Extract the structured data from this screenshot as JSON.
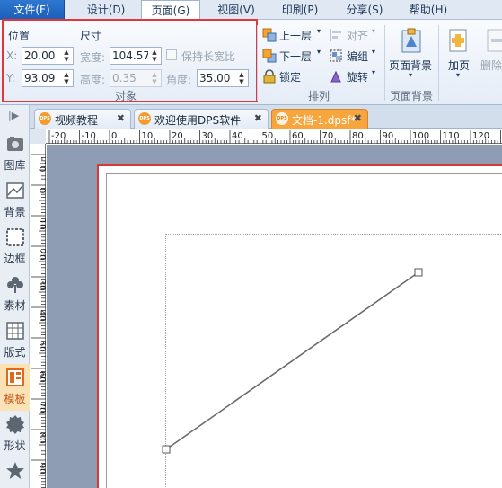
{
  "menu": {
    "file": "文件(F)",
    "design": "设计(D)",
    "page": "页面(G)",
    "view": "视图(V)",
    "print": "印刷(P)",
    "share": "分享(S)",
    "help": "帮助(H)"
  },
  "ribbon": {
    "position_label": "位置",
    "size_label": "尺寸",
    "x_label": "X:",
    "y_label": "Y:",
    "x_value": "20.00",
    "y_value": "93.09",
    "width_label": "宽度:",
    "width_value": "104.57",
    "height_label": "高度:",
    "height_value": "0.35",
    "keep_ratio_label": "保持长宽比",
    "angle_label": "角度:",
    "angle_value": "35.00",
    "object_group": "对象",
    "bring_forward": "上一层",
    "send_backward": "下一层",
    "lock": "锁定",
    "align": "对齐",
    "group": "编组",
    "rotate": "旋转",
    "arrange_group": "排列",
    "page_background": "页面背景",
    "page_background_group": "页面背景",
    "add_page": "加页",
    "delete_page": "删除"
  },
  "left_tools": [
    {
      "label": "图库",
      "icon": "gallery-icon"
    },
    {
      "label": "背景",
      "icon": "background-icon"
    },
    {
      "label": "边框",
      "icon": "border-icon"
    },
    {
      "label": "素材",
      "icon": "material-icon"
    },
    {
      "label": "版式",
      "icon": "layout-icon"
    },
    {
      "label": "模板",
      "icon": "template-icon"
    },
    {
      "label": "形状",
      "icon": "shape-icon"
    },
    {
      "label": "",
      "icon": "star-icon"
    }
  ],
  "tabs": [
    {
      "label": "视频教程",
      "badge": "DPS",
      "close": "✖",
      "active": false
    },
    {
      "label": "欢迎使用DPS软件",
      "badge": "DPS",
      "close": "✖",
      "active": false
    },
    {
      "label": "文档-1.dpsf*",
      "badge": "DPS",
      "close": "✖",
      "active": true
    }
  ],
  "ruler_h": [
    "-20",
    "-10",
    "0",
    "10",
    "20",
    "30",
    "40",
    "50",
    "60",
    "70",
    "80",
    "90",
    "100",
    "110",
    "120",
    "130"
  ],
  "ruler_v": [
    "-10",
    "0",
    "10",
    "20",
    "30",
    "40",
    "50",
    "60",
    "70",
    "80",
    "90"
  ],
  "colors": {
    "highlight": "#e2363e",
    "active_tab": "#f7a53d",
    "file_menu": "#1b5fb7",
    "canvas": "#8e9db3"
  }
}
